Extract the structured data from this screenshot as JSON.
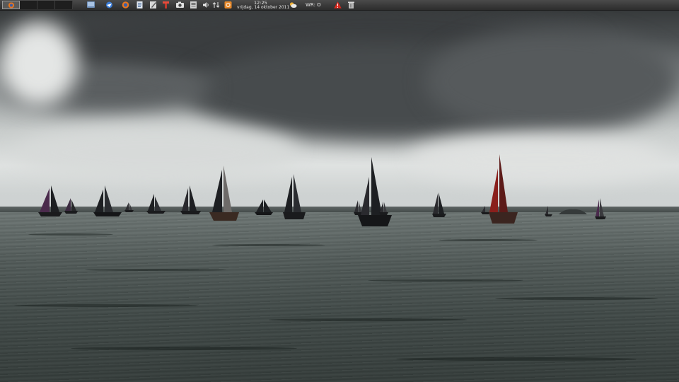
{
  "panel": {
    "pager": {
      "workspaces": [
        {
          "active": true,
          "icon": "firefox-window-icon"
        },
        {
          "active": false
        },
        {
          "active": false
        },
        {
          "active": false
        }
      ]
    },
    "launchers": [
      {
        "name": "desktop-launcher-icon",
        "color": "#6f8fb8"
      },
      {
        "name": "thunderbird-launcher-icon",
        "color": "#3a7bd5"
      },
      {
        "name": "firefox-launcher-icon",
        "color": "#e8761e"
      },
      {
        "name": "text-editor-launcher-icon",
        "color": "#dfe6ef"
      },
      {
        "name": "notes-launcher-icon",
        "color": "#d8d8d8"
      },
      {
        "name": "tools-launcher-icon",
        "color": "#c0392b"
      },
      {
        "name": "screenshot-launcher-icon",
        "color": "#e0e0e0"
      },
      {
        "name": "document-viewer-launcher-icon",
        "color": "#cfcfcf"
      }
    ],
    "tray": {
      "volume_icon": "speaker-icon",
      "network_icon": "network-updown-icon",
      "updates_icon": "updates-icon",
      "clock_time": "12:25",
      "clock_date": "vrijdag, 14 oktober 2011",
      "weather_icon": "weather-partly-cloudy-icon",
      "weather_text": "WR: O",
      "warning_icon": "warning-icon",
      "trash_icon": "trash-icon"
    }
  },
  "wallpaper": {
    "subject": "sailing-boats-on-lake",
    "sail_colors": {
      "dark": "#1d1f22",
      "red": "#8a1f1c",
      "purple": "#4a2a4c",
      "grey": "#6d6d6d"
    }
  }
}
